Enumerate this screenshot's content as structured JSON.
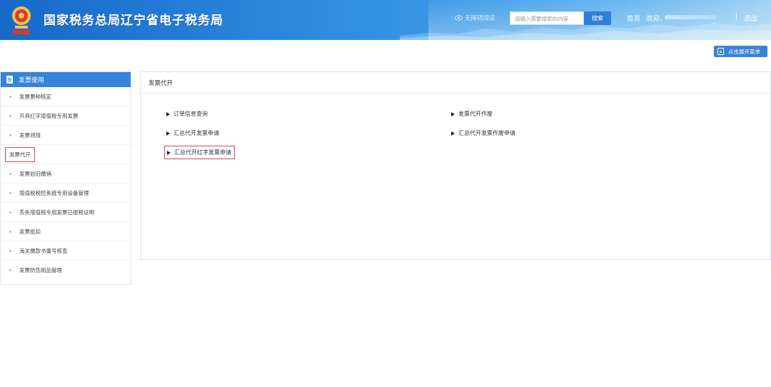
{
  "header": {
    "site_title": "国家税务总局辽宁省电子税务局",
    "accessibility_label": "无障碍阅读",
    "search_placeholder": "请输入需要搜索的内容",
    "search_button": "搜索",
    "home_link": "首页",
    "welcome_text": "欢迎，",
    "separator": "|",
    "logout_link": "退出"
  },
  "toolbar": {
    "expand_menu_label": "点击展开菜单"
  },
  "sidebar": {
    "title": "发票使用",
    "items": [
      {
        "label": "发票票种核定"
      },
      {
        "label": "开具红字增值税专用发票"
      },
      {
        "label": "发票领用"
      },
      {
        "label": "发票代开"
      },
      {
        "label": "发票验旧缴销"
      },
      {
        "label": "增值税税控系统专用设备管理"
      },
      {
        "label": "丢失增值税专用发票已报税证明"
      },
      {
        "label": "发票抵扣"
      },
      {
        "label": "海关缴款书重号核查"
      },
      {
        "label": "发票防伪用品管理"
      }
    ]
  },
  "main": {
    "title": "发票代开",
    "links": [
      {
        "label": "订单信息查询"
      },
      {
        "label": "发票代开作废"
      },
      {
        "label": "汇总代开发票申请"
      },
      {
        "label": "汇总代开发票作废申请"
      },
      {
        "label": "汇总代开红字发票申请"
      }
    ]
  },
  "colors": {
    "header_blue": "#1768c9",
    "accent_blue": "#3584dc",
    "highlight_red": "#e0454a"
  }
}
